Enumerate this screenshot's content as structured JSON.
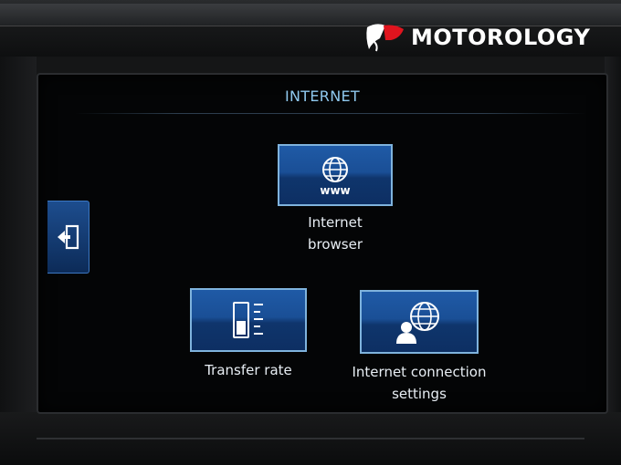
{
  "watermark": {
    "text": "MOTOROLOGY"
  },
  "screen": {
    "title": "INTERNET",
    "back": {
      "icon": "back-exit-icon"
    },
    "tiles": [
      {
        "label_line1": "Internet",
        "label_line2": "browser",
        "icon": "globe-www-icon"
      },
      {
        "label_line1": "Transfer rate",
        "label_line2": "",
        "icon": "transfer-rate-gauge-icon"
      },
      {
        "label_line1": "Internet connection",
        "label_line2": "settings",
        "icon": "globe-user-icon"
      }
    ]
  },
  "colors": {
    "title": "#8fc8ee",
    "tile_border": "#7fb3dd",
    "tile_fill": "#1a4f96",
    "logo_red": "#e0141e"
  }
}
